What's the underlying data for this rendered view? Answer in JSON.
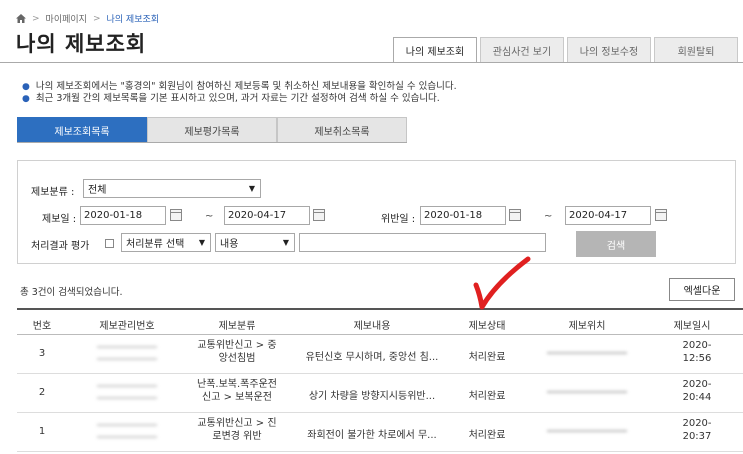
{
  "breadcrumb": {
    "items": [
      "마이페이지",
      "나의 제보조회"
    ]
  },
  "page_title": "나의 제보조회",
  "top_tabs": [
    {
      "label": "나의 제보조회",
      "active": true
    },
    {
      "label": "관심사건 보기",
      "active": false
    },
    {
      "label": "나의 정보수정",
      "active": false
    },
    {
      "label": "회원탈퇴",
      "active": false
    }
  ],
  "notice": [
    "나의 제보조회에서는 \"홍경의\" 회원님이 참여하신 제보등록 및 취소하신 제보내용을 확인하실 수 있습니다.",
    "최근 3개월 간의 제보목록을 기본 표시하고 있으며, 과거 자료는 기간 설정하여 검색 하실 수 있습니다."
  ],
  "sub_tabs": [
    {
      "label": "제보조회목록",
      "active": true
    },
    {
      "label": "제보평가목록",
      "active": false
    },
    {
      "label": "제보취소목록",
      "active": false
    }
  ],
  "search": {
    "category_label": "제보분류 :",
    "category_value": "전체",
    "report_date_label": "제보일 :",
    "report_date_from": "2020-01-18",
    "report_date_to": "2020-04-17",
    "violation_date_label": "위반일 :",
    "violation_date_from": "2020-01-18",
    "violation_date_to": "2020-04-17",
    "tilde": "~",
    "result_label": "처리결과 평가",
    "result_select": "처리분류 선택",
    "content_select": "내용",
    "keyword": "",
    "search_button": "검색"
  },
  "result_count": "총 3건이 검색되었습니다.",
  "excel_button": "엑셀다운",
  "table": {
    "headers": [
      "번호",
      "제보관리번호",
      "제보분류",
      "제보내용",
      "제보상태",
      "제보위치",
      "제보일시"
    ],
    "rows": [
      {
        "no": "3",
        "id": "",
        "category_1": "교통위반신고 > 중",
        "category_2": "앙선침범",
        "content": "유턴신호 무시하며, 중앙선 침...",
        "status": "처리완료",
        "location": "",
        "date": "2020-",
        "time": "12:56"
      },
      {
        "no": "2",
        "id": "",
        "category_1": "난폭.보복.폭주운전",
        "category_2": "신고 > 보복운전",
        "content": "상기 차량을 방향지시등위반...",
        "status": "처리완료",
        "location": "",
        "date": "2020-",
        "time": "20:44"
      },
      {
        "no": "1",
        "id": "",
        "category_1": "교통위반신고 > 진",
        "category_2": "로변경 위반",
        "content": "좌회전이 불가한 차로에서 무...",
        "status": "처리완료",
        "location": "",
        "date": "2020-",
        "time": "20:37"
      }
    ]
  },
  "colors": {
    "accent": "#2d6fc0",
    "checkmark": "#e02020"
  }
}
